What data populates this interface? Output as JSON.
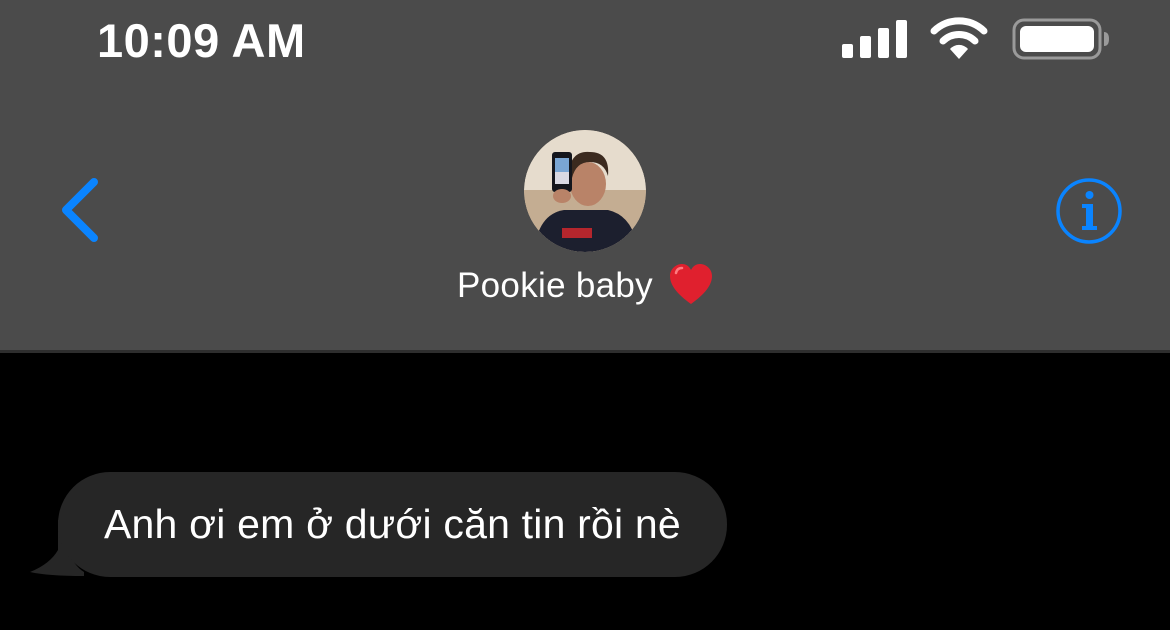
{
  "status_bar": {
    "time": "10:09 AM",
    "signal_icon": "cellular-signal-icon",
    "wifi_icon": "wifi-icon",
    "battery_icon": "battery-icon"
  },
  "header": {
    "back_icon": "chevron-left-icon",
    "info_icon": "info-icon",
    "contact_name": "Pookie baby",
    "contact_emoji_icon": "red-heart-icon",
    "accent_color": "#0a84ff",
    "background_color": "#4b4b4b"
  },
  "messages": [
    {
      "direction": "incoming",
      "text": "Anh ơi em ở dưới căn tin rồi nè",
      "bubble_color": "#262626"
    }
  ]
}
